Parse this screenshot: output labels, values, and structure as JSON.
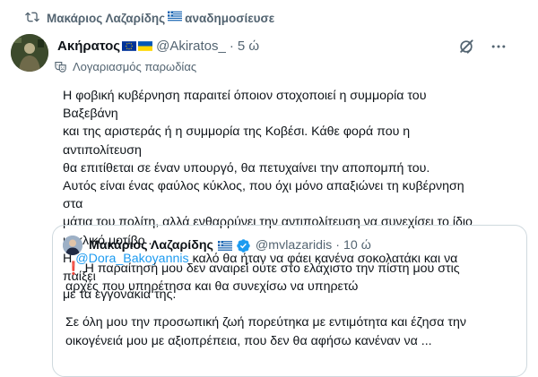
{
  "repost": {
    "user": "Μακάριος Λαζαρίδης",
    "action": "αναδημοσίευσε",
    "flag_icon": "greek-flag-icon"
  },
  "tweet": {
    "display_name": "Ακήρατος",
    "name_flags": [
      "eu-flag-icon",
      "ukraine-flag-icon"
    ],
    "handle": "@Akiratos_",
    "separator": "·",
    "time": "5 ώ",
    "parody_label": "Λογαριασμός παρωδίας",
    "lines": [
      "Η φοβική κυβέρνηση παραιτεί όποιον στοχοποιεί η συμμορία του Βαξεβάνη",
      "και της αριστεράς ή η συμμορία της Κοβέσι. Κάθε φορά που η αντιπολίτευση",
      "θα επιτίθεται σε έναν υπουργό, θα πετυχαίνει την αποπομπή του.",
      "Αυτός είναι ένας φαύλος κύκλος, που όχι μόνο απαξιώνει τη κυβέρνηση στα",
      "μάτια του πολίτη, αλλά ενθαρρύνει την αντιπολίτευση να συνεχίσει το ίδιο",
      "κυκλικό μοτίβο ."
    ],
    "mention_prefix": "Η",
    "mention": "@Dora_Bakoyannis",
    "mention_suffix": "καλό θα ήταν να φάει κανένα σοκολατάκι και να παίξει",
    "last_line": "με τα εγγονάκια της."
  },
  "quote": {
    "display_name": "Μακάριος Λαζαρίδης",
    "flag_icon": "greek-flag-icon",
    "verified_icon": "verified-badge-icon",
    "handle": "@mvlazaridis",
    "separator": "·",
    "time": "10 ώ",
    "exclamation": "❗",
    "line1": "Η παραίτησή μου δεν αναιρεί ούτε στο ελάχιστο την πίστη μου στις",
    "line2": "αρχές που υπηρέτησα και θα συνεχίσω να υπηρετώ",
    "line3": "Σε όλη μου την προσωπική ζωή πορεύτηκα με εντιμότητα και έζησα την",
    "line4": "οικογένειά μου με αξιοπρέπεια, που δεν θα αφήσω κανέναν να ..."
  },
  "colors": {
    "text": "#0f1419",
    "secondary": "#536471",
    "link": "#1d9bf0",
    "border": "#cfd9de"
  }
}
